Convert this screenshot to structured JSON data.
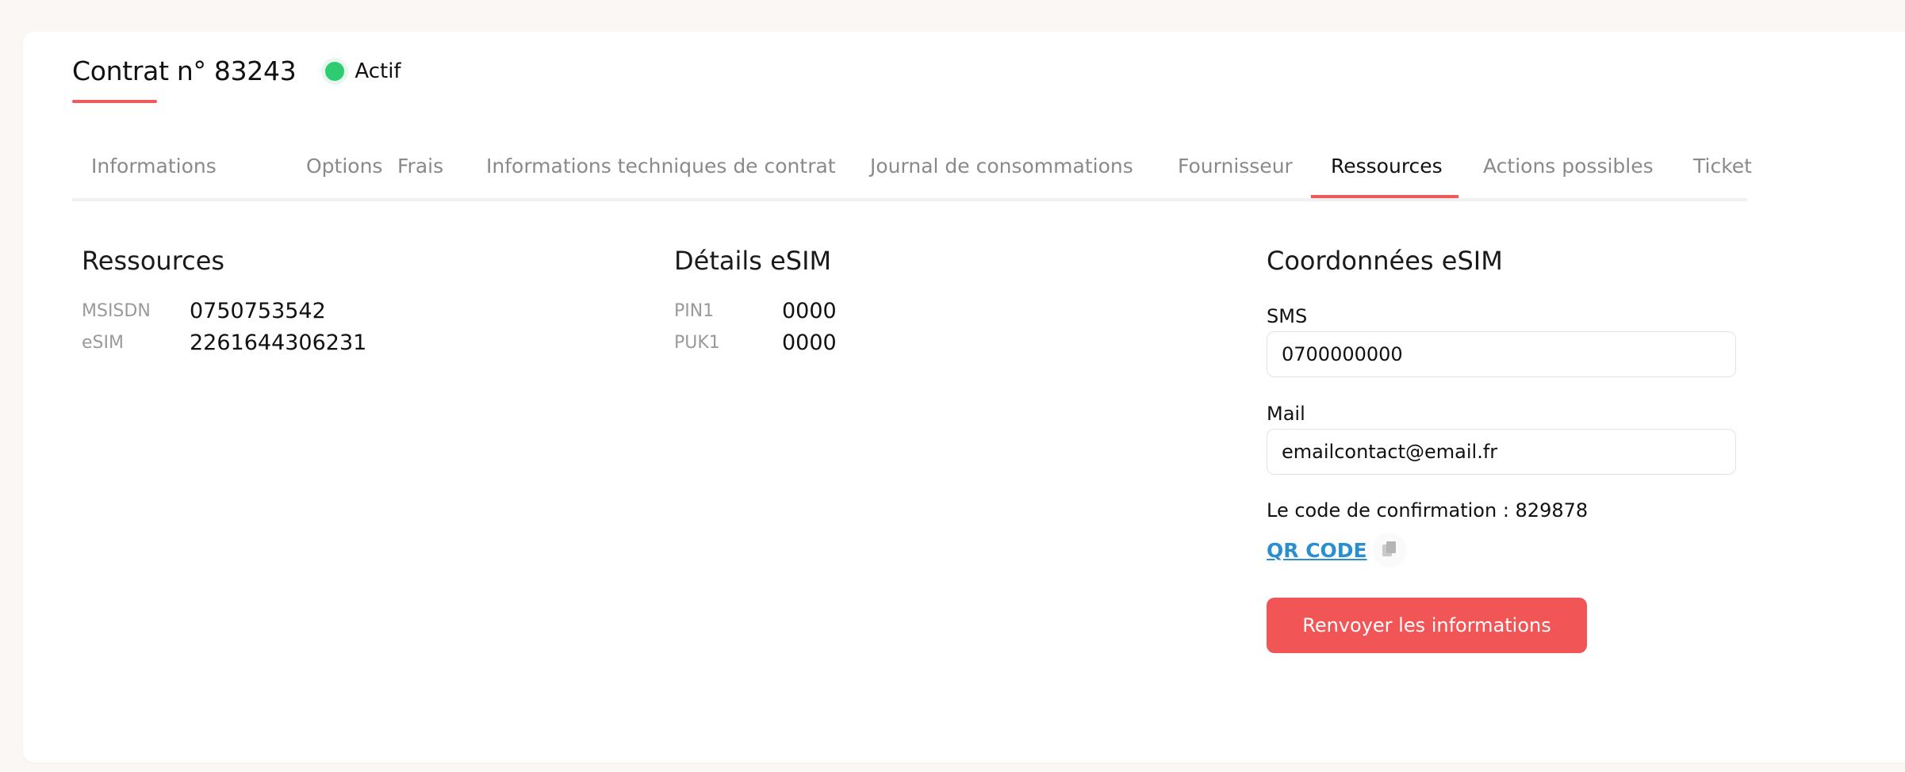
{
  "header": {
    "title": "Contrat n° 83243",
    "status": "Actif",
    "status_color": "#2ecc71",
    "accent_color": "#f05a5a"
  },
  "tabs": [
    {
      "label": "Informations",
      "active": false
    },
    {
      "label": "Options",
      "active": false
    },
    {
      "label": "Frais",
      "active": false
    },
    {
      "label": "Informations techniques de contrat",
      "active": false
    },
    {
      "label": "Journal de consommations",
      "active": false
    },
    {
      "label": "Fournisseur",
      "active": false
    },
    {
      "label": "Ressources",
      "active": true
    },
    {
      "label": "Actions possibles",
      "active": false
    },
    {
      "label": "Ticket",
      "active": false
    }
  ],
  "ressources": {
    "title": "Ressources",
    "rows": [
      {
        "key": "MSISDN",
        "value": "0750753542"
      },
      {
        "key": "eSIM",
        "value": "2261644306231"
      }
    ]
  },
  "details": {
    "title": "Détails eSIM",
    "rows": [
      {
        "key": "PIN1",
        "value": "0000"
      },
      {
        "key": "PUK1",
        "value": "0000"
      }
    ]
  },
  "coordonnees": {
    "title": "Coordonnées eSIM",
    "sms_label": "SMS",
    "sms_value": "0700000000",
    "mail_label": "Mail",
    "mail_value": "emailcontact@email.fr",
    "confirmation_text": "Le code de confirmation : 829878",
    "qr_label": "QR CODE",
    "copy_icon": "copy-icon",
    "resend_label": "Renvoyer les informations",
    "button_color": "#f25555"
  }
}
